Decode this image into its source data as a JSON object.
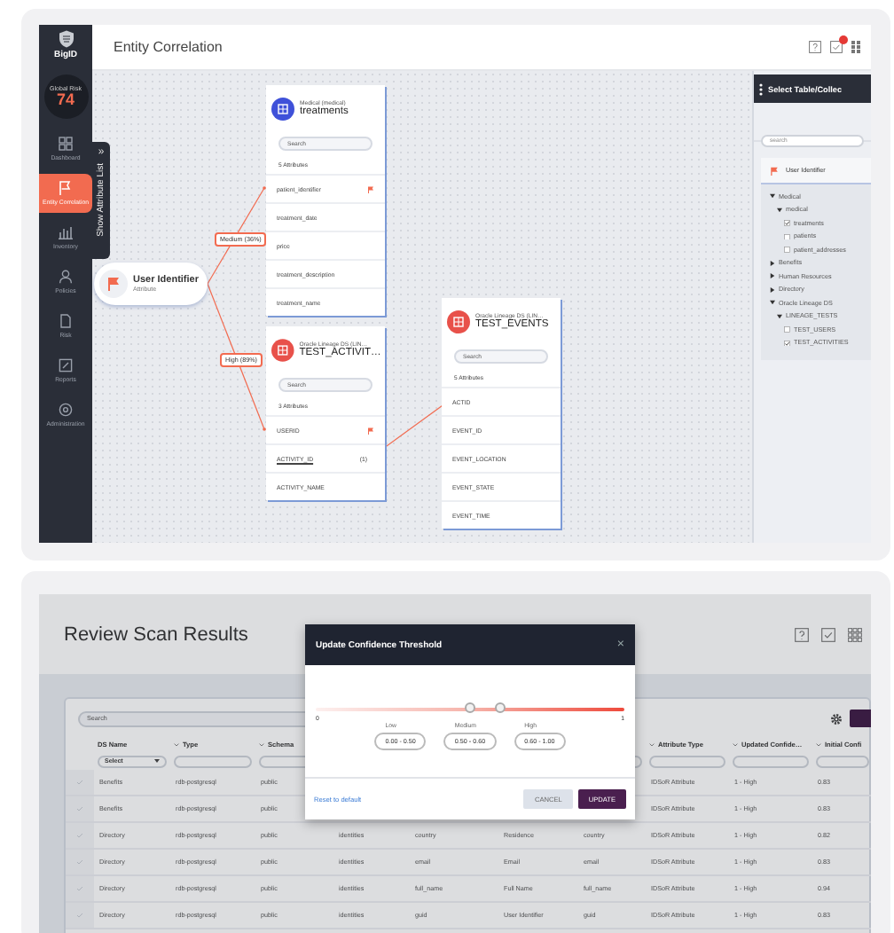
{
  "entity_correlation": {
    "sidebar": {
      "logo": "BigID",
      "risk_label": "Global Risk",
      "risk_value": "74",
      "items": [
        {
          "label": "Dashboard",
          "selected": false
        },
        {
          "label": "Entity Correlation",
          "selected": true
        },
        {
          "label": "Inventory",
          "selected": false
        },
        {
          "label": "Policies",
          "selected": false
        },
        {
          "label": "Risk",
          "selected": false
        },
        {
          "label": "Reports",
          "selected": false
        },
        {
          "label": "Administration",
          "selected": false
        }
      ]
    },
    "attribute_list_tab": {
      "toggle": "»",
      "label": "Show Attribute List"
    },
    "header": {
      "title": "Entity Correlation",
      "notifications_unread": true
    },
    "diagram": {
      "source": {
        "title": "User Identifier",
        "subtitle": "Attribute"
      },
      "links": [
        {
          "label": "Medium (36%)"
        },
        {
          "label": "High (89%)"
        }
      ],
      "cards": [
        {
          "color": "#3f51d9",
          "source": "Medical (medical)",
          "title": "treatments",
          "search_placeholder": "Search",
          "count": "5 Attributes",
          "attributes": [
            {
              "name": "patient_identifier",
              "flagged": true,
              "linked": false
            },
            {
              "name": "treatment_date",
              "flagged": false,
              "linked": false
            },
            {
              "name": "price",
              "flagged": false,
              "linked": false
            },
            {
              "name": "treatment_description",
              "flagged": false,
              "linked": false
            },
            {
              "name": "treatment_name",
              "flagged": false,
              "linked": false
            }
          ]
        },
        {
          "color": "#e8514a",
          "source": "Oracle Lineage DS (LIN…",
          "title": "TEST_ACTIVIT…",
          "search_placeholder": "Search",
          "count": "3 Attributes",
          "attributes": [
            {
              "name": "USERID",
              "flagged": true,
              "linked": false
            },
            {
              "name": "ACTIVITY_ID",
              "flagged": false,
              "linked": true,
              "note": "(1)"
            },
            {
              "name": "ACTIVITY_NAME",
              "flagged": false,
              "linked": false
            }
          ]
        },
        {
          "color": "#e8514a",
          "source": "Oracle Lineage DS (LIN…",
          "title": "TEST_EVENTS",
          "search_placeholder": "Search",
          "count": "5 Attributes",
          "attributes": [
            {
              "name": "ACTID",
              "flagged": false,
              "linked": false
            },
            {
              "name": "EVENT_ID",
              "flagged": false,
              "linked": false
            },
            {
              "name": "EVENT_LOCATION",
              "flagged": false,
              "linked": false
            },
            {
              "name": "EVENT_STATE",
              "flagged": false,
              "linked": false
            },
            {
              "name": "EVENT_TIME",
              "flagged": false,
              "linked": false
            }
          ]
        }
      ]
    },
    "table_panel": {
      "title": "Select Table/Collec",
      "search_placeholder": "search",
      "attribute": "User Identifier",
      "tree": [
        {
          "kind": "folder",
          "label": "Medical",
          "expanded": true,
          "children": [
            {
              "kind": "folder",
              "label": "medical",
              "expanded": true,
              "children": [
                {
                  "kind": "table",
                  "label": "treatments",
                  "checked": true
                },
                {
                  "kind": "table",
                  "label": "patients",
                  "checked": false
                },
                {
                  "kind": "table",
                  "label": "patient_addresses",
                  "checked": false
                }
              ]
            }
          ]
        },
        {
          "kind": "folder",
          "label": "Benefits",
          "expanded": false
        },
        {
          "kind": "folder",
          "label": "Human Resources",
          "expanded": false
        },
        {
          "kind": "folder",
          "label": "Directory",
          "expanded": false
        },
        {
          "kind": "folder",
          "label": "Oracle Lineage DS",
          "expanded": true,
          "children": [
            {
              "kind": "folder",
              "label": "LINEAGE_TESTS",
              "expanded": true,
              "children": [
                {
                  "kind": "table",
                  "label": "TEST_USERS",
                  "checked": false
                },
                {
                  "kind": "table",
                  "label": "TEST_ACTIVITIES",
                  "checked": true
                }
              ]
            }
          ]
        }
      ]
    }
  },
  "review_scan_results": {
    "title": "Review Scan Results",
    "table": {
      "search_placeholder": "Search",
      "columns": [
        {
          "label": "DS Name",
          "filter": {
            "kind": "select",
            "value": "Select"
          }
        },
        {
          "label": "Type",
          "filter": {
            "kind": "text"
          }
        },
        {
          "label": "Schema",
          "filter": {
            "kind": "text"
          }
        },
        {
          "label": "Attribute Type",
          "filter": {
            "kind": "text"
          }
        },
        {
          "label": "Updated Confide…",
          "filter": {
            "kind": "text"
          }
        },
        {
          "label": "Initial Confi",
          "filter": {
            "kind": "text"
          }
        }
      ],
      "rows": [
        {
          "selected": false,
          "cells": [
            "Benefits",
            "rdb-postgresql",
            "public",
            "IDSoR Attribute",
            "1 - High",
            "0.83"
          ]
        },
        {
          "selected": false,
          "cells": [
            "Benefits",
            "rdb-postgresql",
            "public",
            "IDSoR Attribute",
            "1 - High",
            "0.83"
          ]
        },
        {
          "selected": false,
          "cells": [
            "Directory",
            "rdb-postgresql",
            "public",
            "IDSoR Attribute",
            "1 - High",
            "0.82"
          ],
          "middle_cells": [
            "identities",
            "country",
            "Residence",
            "country"
          ]
        },
        {
          "selected": false,
          "cells": [
            "Directory",
            "rdb-postgresql",
            "public",
            "IDSoR Attribute",
            "1 - High",
            "0.83"
          ],
          "middle_cells": [
            "identities",
            "email",
            "Email",
            "email"
          ]
        },
        {
          "selected": false,
          "cells": [
            "Directory",
            "rdb-postgresql",
            "public",
            "IDSoR Attribute",
            "1 - High",
            "0.94"
          ],
          "middle_cells": [
            "identities",
            "full_name",
            "Full Name",
            "full_name"
          ]
        },
        {
          "selected": false,
          "cells": [
            "Directory",
            "rdb-postgresql",
            "public",
            "IDSoR Attribute",
            "1 - High",
            "0.83"
          ],
          "middle_cells": [
            "identities",
            "guid",
            "User Identifier",
            "guid"
          ]
        }
      ]
    },
    "dialog": {
      "title": "Update Confidence Threshold",
      "close": "×",
      "slider": {
        "min": "0",
        "max": "1",
        "thumbs": [
          {
            "level": 0.5
          },
          {
            "level": 0.6
          }
        ]
      },
      "ranges": [
        {
          "label": "Low",
          "value": "0.00 - 0.50"
        },
        {
          "label": "Medium",
          "value": "0.50 - 0.60"
        },
        {
          "label": "High",
          "value": "0.60 - 1.00"
        }
      ],
      "reset": "Reset to default",
      "buttons": [
        {
          "label": "CANCEL",
          "kind": "secondary"
        },
        {
          "label": "UPDATE",
          "kind": "primary"
        }
      ]
    }
  }
}
